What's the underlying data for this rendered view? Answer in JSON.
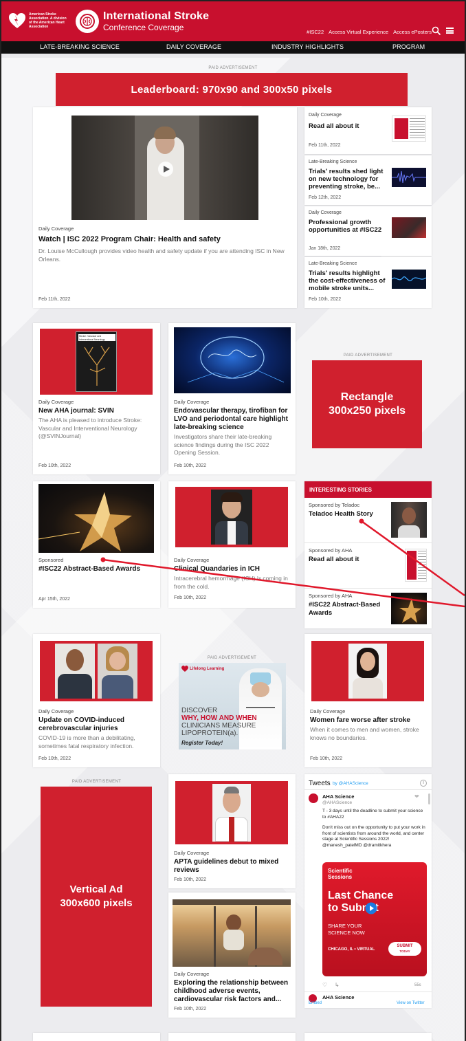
{
  "header": {
    "aha_logo_text": "American Stroke Association. A division of the American Heart Association",
    "site_title": "International Stroke",
    "site_subtitle": "Conference Coverage",
    "links": [
      "#ISC22",
      "Access Virtual Experience",
      "Access ePosters"
    ]
  },
  "nav": {
    "items": [
      "LATE-BREAKING SCIENCE",
      "DAILY COVERAGE",
      "INDUSTRY HIGHLIGHTS",
      "PROGRAM"
    ]
  },
  "paid_label": "PAID ADVERTISEMENT",
  "leaderboard": {
    "label": "Leaderboard: 970x90 and 300x50 pixels"
  },
  "featured": {
    "category": "Daily Coverage",
    "title": "Watch | ISC 2022 Program Chair: Health and safety",
    "description": "Dr. Louise McCullough provides video health and safety update if you are attending ISC in New Orleans.",
    "date": "Feb 11th, 2022"
  },
  "sidebar_top": [
    {
      "category": "Daily Coverage",
      "title": "Read all about it",
      "date": "Feb 11th, 2022"
    },
    {
      "category": "Late-Breaking Science",
      "title": "Trials' results shed light on new technology for preventing stroke, be...",
      "date": "Feb 12th, 2022"
    },
    {
      "category": "Daily Coverage",
      "title": "Professional growth opportunities at #ISC22",
      "date": "Jan 18th, 2022"
    },
    {
      "category": "Late-Breaking Science",
      "title": "Trials' results highlight the cost-effectiveness of mobile stroke units...",
      "date": "Feb 10th, 2022"
    }
  ],
  "row2": [
    {
      "category": "Daily Coverage",
      "title": "New AHA journal: SVIN",
      "description": "The AHA is pleased to introduce Stroke: Vascular and Interventional Neurology (@SVINJournal)",
      "date": "Feb 10th, 2022",
      "journal_cover": "Stroke: Vascular and Interventional Neurology"
    },
    {
      "category": "Daily Coverage",
      "title": "Endovascular therapy, tirofiban for LVO and periodontal care highlight late-breaking science",
      "description": "Investigators share their late-breaking science findings during the ISC 2022 Opening Session.",
      "date": "Feb 10th, 2022"
    }
  ],
  "rectangle_ad": {
    "line1": "Rectangle",
    "line2": "300x250 pixels"
  },
  "row3": [
    {
      "category": "Sponsored",
      "title": "#ISC22 Abstract-Based Awards",
      "date": "Apr 15th, 2022"
    },
    {
      "category": "Daily Coverage",
      "title": "Clinical Quandaries in ICH",
      "description": "Intracerebral hemorrhage (ICH) is coming in from the cold.",
      "date": "Feb 10th, 2022"
    }
  ],
  "interesting": {
    "header": "INTERESTING STORIES",
    "items": [
      {
        "sponsor": "Sponsored by Teladoc",
        "title": "Teladoc Health Story"
      },
      {
        "sponsor": "Sponsored by AHA",
        "title": "Read all about it"
      },
      {
        "sponsor": "Sponsored by AHA",
        "title": "#ISC22 Abstract-Based Awards"
      }
    ]
  },
  "row4": [
    {
      "category": "Daily Coverage",
      "title": "Update on COVID-induced cerebrovascular injuries",
      "description": "COVID-19 is more than a debilitating, sometimes fatal respiratory infection.",
      "date": "Feb 10th, 2022"
    },
    {
      "category": "Daily Coverage",
      "title": "Women fare worse after stroke",
      "description": "When it comes to men and women, stroke knows no boundaries.",
      "date": "Feb 10th, 2022"
    }
  ],
  "lifelong_ad": {
    "brand": "Lifelong Learning",
    "line1": "DISCOVER",
    "line2": "WHY, HOW AND WHEN",
    "line3": "CLINICIANS MEASURE",
    "line4": "LIPOPROTEIN(a).",
    "cta": "Register Today!"
  },
  "vertical_ad": {
    "line1": "Vertical Ad",
    "line2": "300x600 pixels"
  },
  "row5": [
    {
      "category": "Daily Coverage",
      "title": "APTA guidelines debut to mixed reviews",
      "date": "Feb 10th, 2022"
    },
    {
      "category": "Daily Coverage",
      "title": "Exploring the relationship between childhood adverse events, cardiovascular risk factors and...",
      "date": "Feb 10th, 2022"
    }
  ],
  "tweets": {
    "header": "Tweets",
    "by": "by @AHAScience",
    "author": "AHA Science",
    "handle": "@AHAScience",
    "text1": "T - 3 days until the deadline to submit your science to #AHA22",
    "text2": "Don't miss out on the opportunity to put your work in front of scientists from around the world, and center stage at Scientific Sessions 2022! @manesh_patelMD @dramitkhera",
    "promo_brand": "Scientific Sessions",
    "promo_line1": "Last Chance",
    "promo_line2": "to Submit",
    "promo_line3": "SHARE YOUR SCIENCE NOW",
    "promo_loc": "CHICAGO, IL • VIRTUAL",
    "promo_btn": "SUBMIT",
    "promo_btn_sub": "TODAY",
    "age": "55s",
    "author2": "AHA Science",
    "embed": "Embed",
    "view": "View on Twitter"
  },
  "colors": {
    "brand_red": "#c8102e",
    "nav_black": "#111111",
    "ad_red": "#d0202e"
  }
}
